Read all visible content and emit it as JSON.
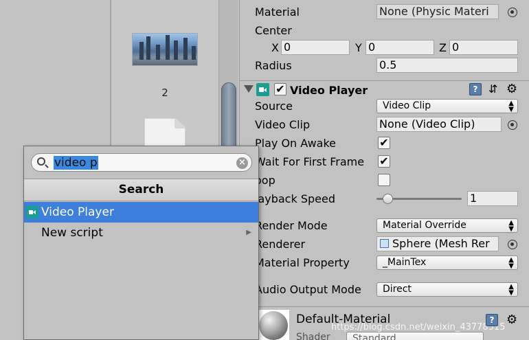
{
  "project": {
    "assets": [
      {
        "label": "2"
      }
    ]
  },
  "inspector": {
    "material_label": "Material",
    "material_value": "None (Physic Materi",
    "center_label": "Center",
    "center": {
      "x_label": "X",
      "x": "0",
      "y_label": "Y",
      "y": "0",
      "z_label": "Z",
      "z": "0"
    },
    "radius_label": "Radius",
    "radius_value": "0.5",
    "component": {
      "title": "Video Player",
      "enabled": true,
      "source_label": "Source",
      "source_value": "Video Clip",
      "video_clip_label": "Video Clip",
      "video_clip_value": "None (Video Clip)",
      "play_on_awake_label": "Play On Awake",
      "play_on_awake": true,
      "wait_first_frame_label": "Wait For First Frame",
      "wait_first_frame": true,
      "loop_label": "oop",
      "loop": false,
      "playback_speed_label": "layback Speed",
      "playback_speed_value": "1",
      "render_mode_label": "Render Mode",
      "render_mode_value": "Material Override",
      "renderer_label": "Renderer",
      "renderer_value": "Sphere (Mesh Rer",
      "material_property_label": "Material Property",
      "material_property_value": "_MainTex",
      "audio_output_label": "Audio Output Mode",
      "audio_output_value": "Direct"
    },
    "material_section": {
      "name": "Default-Material",
      "shader_label": "Shader",
      "shader_value": "Standard",
      "watermark": "https://blog.csdn.net/weixin_43778515"
    }
  },
  "popup": {
    "search_value": "video p",
    "header": "Search",
    "items": [
      {
        "label": "Video Player",
        "selected": true,
        "icon": "video-player-icon"
      },
      {
        "label": "New script",
        "selected": false,
        "has_submenu": true
      }
    ]
  },
  "colors": {
    "selection": "#3d7fdb",
    "video_icon": "#1a9e92",
    "panel_bg": "#c2c2c2"
  }
}
